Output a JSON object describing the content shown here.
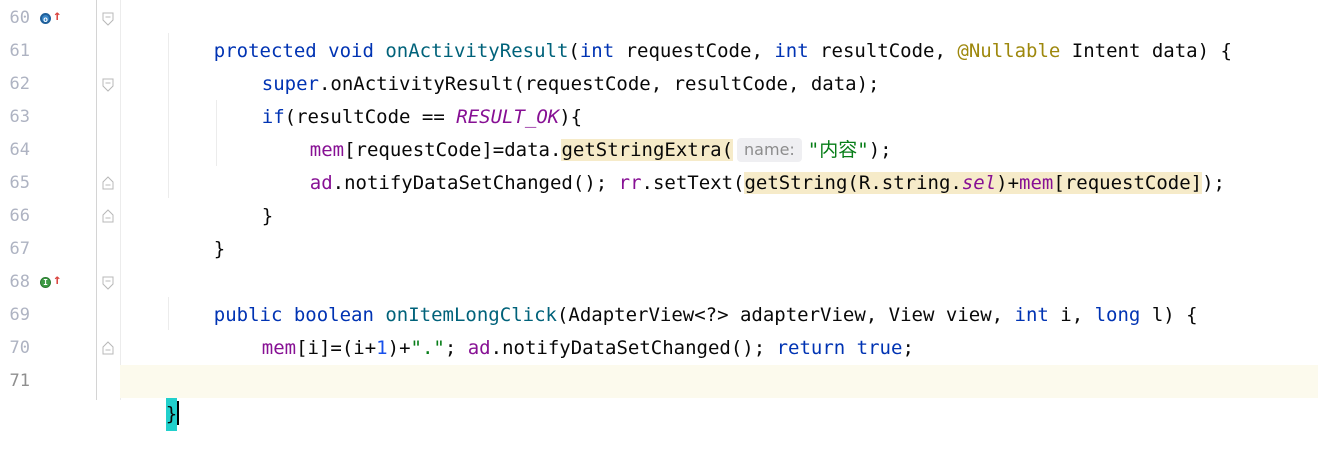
{
  "editor": {
    "current_line": 71,
    "line_numbers": [
      "60",
      "61",
      "62",
      "63",
      "64",
      "65",
      "66",
      "67",
      "68",
      "69",
      "70",
      "71"
    ],
    "gutter_markers": {
      "line60": {
        "kind": "override-icon",
        "circle_glyph": "o",
        "arrow_glyph": "↑"
      },
      "line68": {
        "kind": "implement-icon",
        "circle_glyph": "I",
        "arrow_glyph": "↑"
      }
    },
    "colors": {
      "keyword": "#0033b3",
      "method_declaration": "#00627a",
      "annotation": "#9e880d",
      "field": "#871094",
      "number": "#1750eb",
      "string": "#067d17",
      "highlight": "#f6ebc9",
      "current_line": "#fcfaed",
      "caret_bracket": "#21d0cc"
    },
    "code": {
      "l60": {
        "t1": "protected void ",
        "t2": "onActivityResult",
        "t3": "(",
        "t4": "int",
        "t5": " requestCode, ",
        "t6": "int",
        "t7": " resultCode, ",
        "t8": "@Nullable",
        "t9": " Intent data) {"
      },
      "l61": {
        "t1": "super",
        "t2": ".onActivityResult(requestCode, resultCode, data);"
      },
      "l62": {
        "t1": "if",
        "t2": "(resultCode == ",
        "t3": "RESULT_OK",
        "t4": "){"
      },
      "l63": {
        "t1": "mem",
        "t2": "[requestCode]=data.",
        "t3": "getStringExtra(",
        "hint": "name:",
        "t4": "\"内容\"",
        "t5": ");"
      },
      "l64": {
        "t1": "ad",
        "t2": ".notifyDataSetChanged(); ",
        "t3": "rr",
        "t4": ".setText(",
        "t5": "getString(R.string.",
        "t6": "sel",
        "t7": ")+",
        "t8": "mem",
        "t9": "[requestCode]",
        "t10": ");"
      },
      "l65": {
        "t1": "}"
      },
      "l66": {
        "t1": "}"
      },
      "l68": {
        "t1": "public boolean ",
        "t2": "onItemLongClick",
        "t3": "(AdapterView<?> adapterView, View view, ",
        "t4": "int",
        "t5": " i, ",
        "t6": "long",
        "t7": " l) {"
      },
      "l69": {
        "t1": "mem",
        "t2": "[i]=(i+",
        "t3": "1",
        "t4": ")+",
        "t5": "\".\"",
        "t6": "; ",
        "t7": "ad",
        "t8": ".notifyDataSetChanged(); ",
        "t9": "return true",
        "t10": ";"
      },
      "l70": {
        "t1": "}"
      },
      "l71": {
        "t1": "}"
      }
    }
  }
}
